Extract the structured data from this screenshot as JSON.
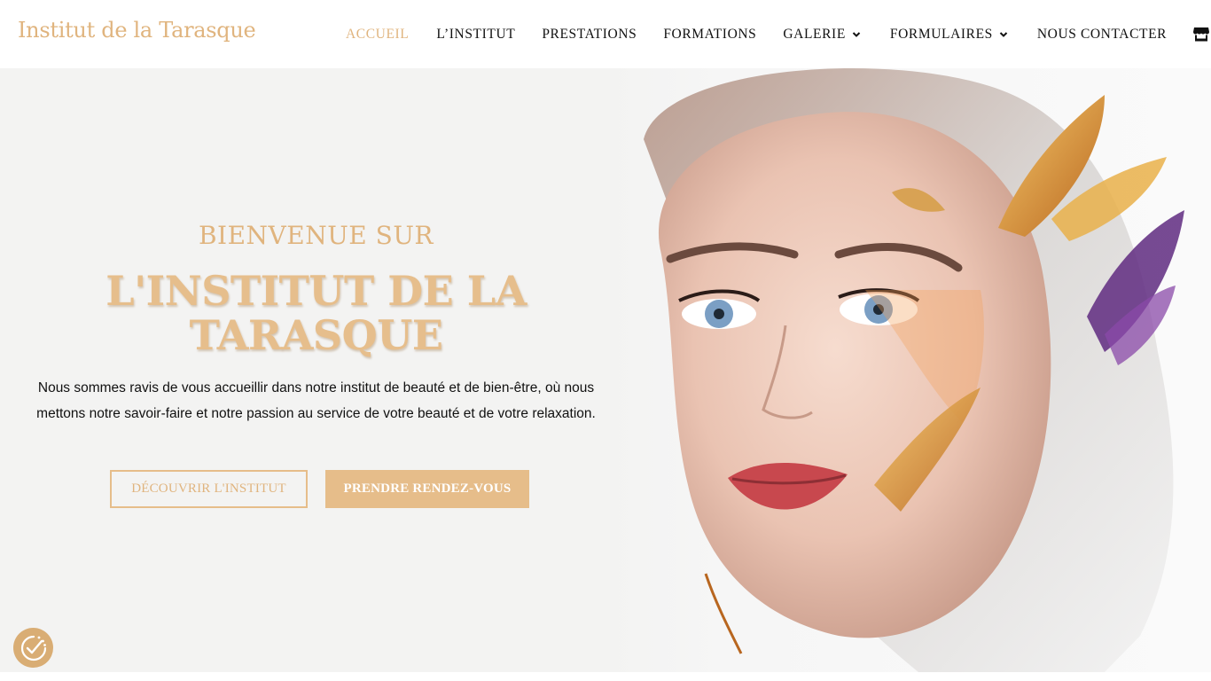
{
  "site": {
    "logo": "Institut de la Tarasque"
  },
  "nav": {
    "items": [
      {
        "label": "ACCUEIL",
        "active": true
      },
      {
        "label": "L’INSTITUT",
        "active": false
      },
      {
        "label": "PRESTATIONS",
        "active": false
      },
      {
        "label": "FORMATIONS",
        "active": false
      },
      {
        "label": "GALERIE",
        "active": false,
        "dropdown": true
      },
      {
        "label": "FORMULAIRES",
        "active": false,
        "dropdown": true
      },
      {
        "label": "NOUS CONTACTER",
        "active": false
      }
    ],
    "icons": [
      "store-icon",
      "user-icon"
    ]
  },
  "hero": {
    "eyebrow": "BIENVENUE SUR",
    "title_line1": "L'INSTITUT DE LA",
    "title_line2": "TARASQUE",
    "intro_line1": "Nous sommes ravis de vous accueillir dans notre institut de beauté et de bien-être, où nous",
    "intro_line2": "mettons notre savoir-faire et notre passion au service de votre beauté et de votre relaxation.",
    "btn_discover": "DÉCOUVRIR L'INSTITUT",
    "btn_book": "PRENDRE RENDEZ-VOUS"
  },
  "colors": {
    "accent": "#e0b47e",
    "accent_button": "#e6bd8a",
    "background": "#f3f3f2",
    "text": "#111111"
  },
  "accessibility": {
    "icon": "accessibility-icon"
  }
}
